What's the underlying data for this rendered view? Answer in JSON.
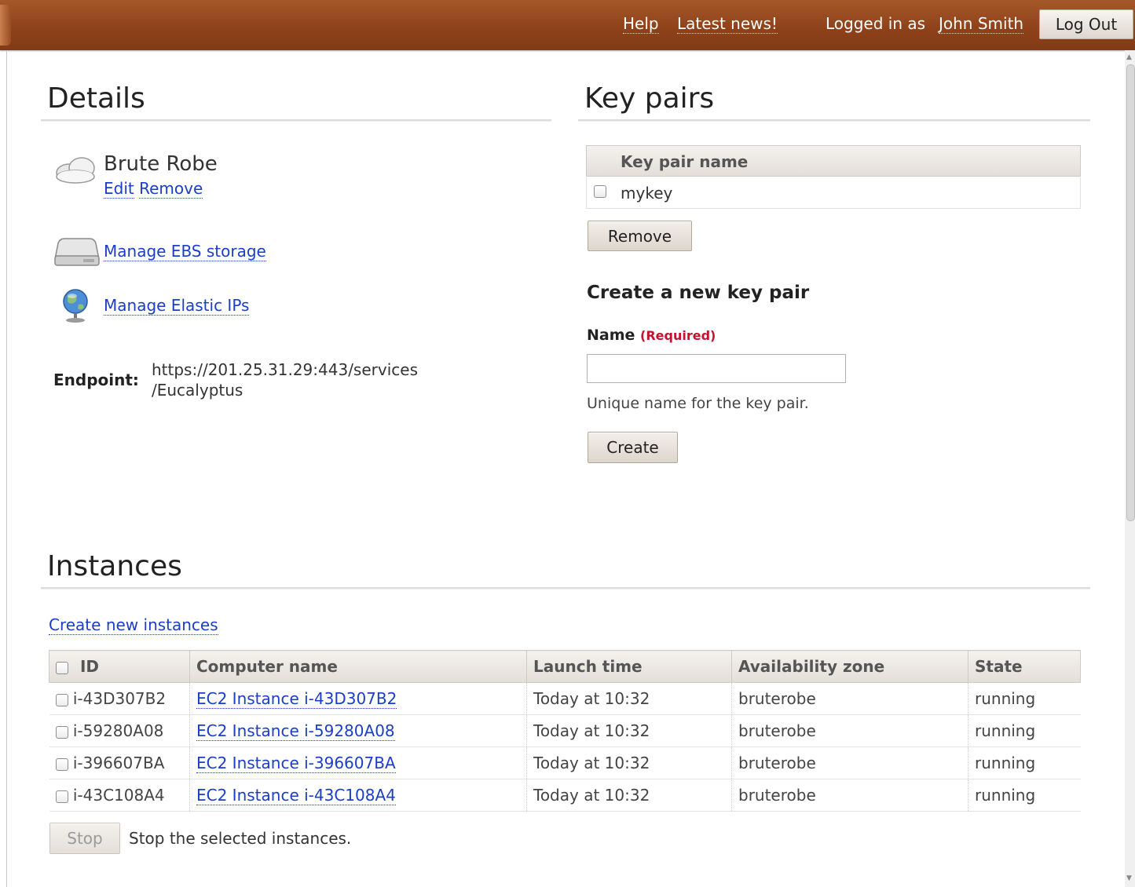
{
  "topbar": {
    "help": "Help",
    "latest_news": "Latest news!",
    "logged_in_prefix": "Logged in as",
    "user": "John Smith",
    "logout": "Log Out"
  },
  "details": {
    "title": "Details",
    "cloud_name": "Brute Robe",
    "edit": "Edit",
    "remove": "Remove",
    "manage_ebs": "Manage EBS storage",
    "manage_ips": "Manage Elastic IPs",
    "endpoint_label": "Endpoint:",
    "endpoint_line1": "https://201.25.31.29:443/services",
    "endpoint_line2": "/Eucalyptus"
  },
  "keypairs": {
    "title": "Key pairs",
    "column": "Key pair name",
    "rows": [
      "mykey"
    ],
    "remove_button": "Remove",
    "create_heading": "Create a new key pair",
    "name_label": "Name",
    "required": "(Required)",
    "name_value": "",
    "help_text": "Unique name for the key pair.",
    "create_button": "Create"
  },
  "instances": {
    "title": "Instances",
    "create_link": "Create new instances",
    "columns": [
      "ID",
      "Computer name",
      "Launch time",
      "Availability zone",
      "State"
    ],
    "rows": [
      {
        "id": "i-43D307B2",
        "name": "EC2 Instance i-43D307B2",
        "launch": "Today at 10:32",
        "zone": "bruterobe",
        "state": "running"
      },
      {
        "id": "i-59280A08",
        "name": "EC2 Instance i-59280A08",
        "launch": "Today at 10:32",
        "zone": "bruterobe",
        "state": "running"
      },
      {
        "id": "i-396607BA",
        "name": "EC2 Instance i-396607BA",
        "launch": "Today at 10:32",
        "zone": "bruterobe",
        "state": "running"
      },
      {
        "id": "i-43C108A4",
        "name": "EC2 Instance i-43C108A4",
        "launch": "Today at 10:32",
        "zone": "bruterobe",
        "state": "running"
      }
    ],
    "stop_button": "Stop",
    "stop_text": "Stop the selected instances."
  },
  "colors": {
    "topbar": "#8e4119",
    "link": "#1a3ec8",
    "required": "#c4122f"
  }
}
